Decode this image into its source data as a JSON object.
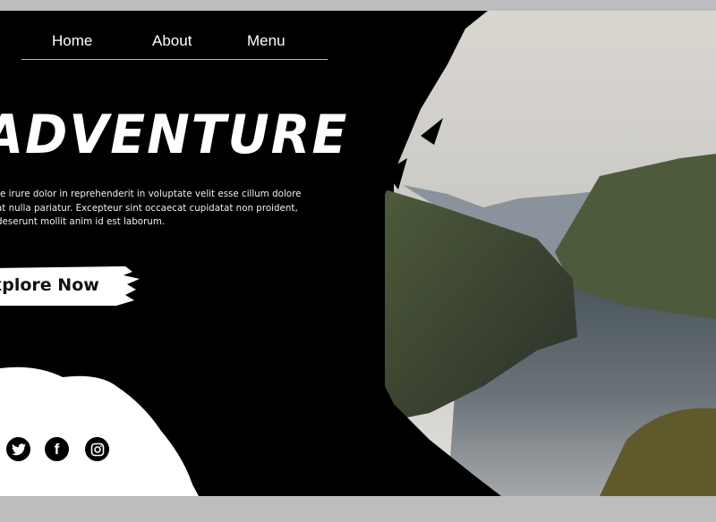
{
  "nav": {
    "items": [
      {
        "label": "Home"
      },
      {
        "label": "About"
      },
      {
        "label": "Menu"
      }
    ]
  },
  "hero": {
    "title": "ADVENTURE",
    "description": [
      "te irure dolor in reprehenderit in voluptate velit esse cillum dolore",
      "at nulla pariatur. Excepteur sint occaecat cupidatat non proident,",
      "deserunt mollit anim id est laborum."
    ],
    "cta_label": "xplore Now"
  },
  "social": [
    {
      "icon": "twitter-icon"
    },
    {
      "icon": "facebook-icon"
    },
    {
      "icon": "instagram-icon"
    }
  ],
  "colors": {
    "background": "#000000",
    "text": "#ffffff",
    "frame": "#bdbdbd"
  }
}
